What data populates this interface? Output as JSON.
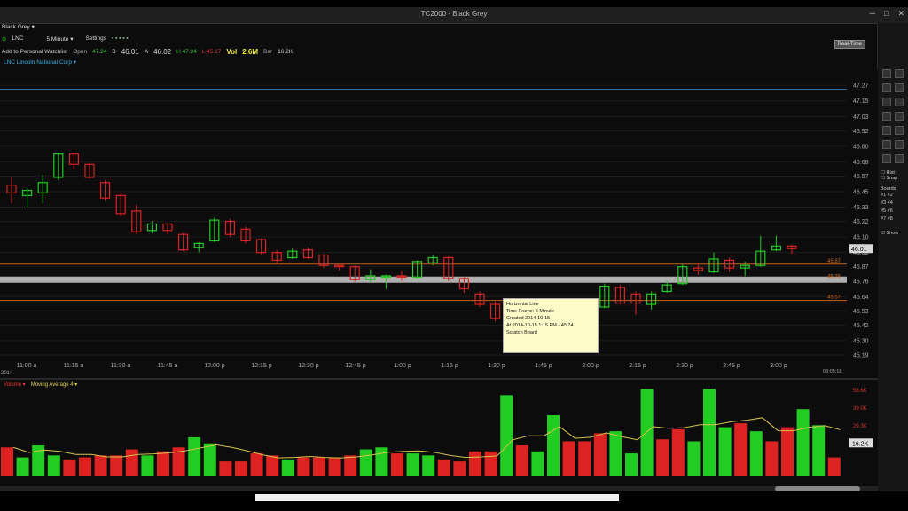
{
  "window": {
    "title": "TC2000 - Black Grey",
    "min": "─",
    "max": "□",
    "close": "✕"
  },
  "layout": {
    "name": "Black Grey ▾"
  },
  "toolbar": {
    "symbol": "LNC",
    "interval": "5 Minute ▾",
    "settings": "Settings"
  },
  "quote": {
    "add_watchlist": "Add to Personal Watchlist",
    "open_label": "Open",
    "open": "47.24",
    "bid_label": "B",
    "bid": "46.01",
    "ask_label": "A",
    "ask": "46.02",
    "high": "H 47.24",
    "low": "L 45.17",
    "vol_label": "Vol",
    "vol": "2.6M",
    "bar_label": "Bar",
    "bar": "16.2K"
  },
  "realtime_button": "Real-Time",
  "symbol_title": "LNC Lincoln National Corp ▾",
  "price_axis": [
    "47.27",
    "47.15",
    "47.03",
    "46.92",
    "46.80",
    "46.68",
    "46.57",
    "46.45",
    "46.33",
    "46.22",
    "46.10",
    "45.98",
    "45.87",
    "45.76",
    "45.64",
    "45.53",
    "45.42",
    "45.30",
    "45.19"
  ],
  "current_price": "46.01",
  "hlines": [
    {
      "price": 47.24,
      "color": "#2f7fc0",
      "label": ""
    },
    {
      "price": 45.89,
      "color": "#d2691e",
      "label": "45.87"
    },
    {
      "price": 45.77,
      "color": "#b8b8b8",
      "label": "45.76"
    },
    {
      "price": 45.61,
      "color": "#d2691e",
      "label": "45.57"
    }
  ],
  "time_axis": [
    "11:00 a",
    "11:15 a",
    "11:30 a",
    "11:45 a",
    "12:00 p",
    "12:15 p",
    "12:30 p",
    "12:45 p",
    "1:00 p",
    "1:15 p",
    "1:30 p",
    "1:45 p",
    "2:00 p",
    "2:15 p",
    "2:30 p",
    "2:45 p",
    "3:00 p"
  ],
  "date_label": "2014",
  "time_right": "03:05:18",
  "tooltip": {
    "title": "Horizontal Line",
    "line1": "Time-Frame: 5 Minute",
    "line2": "Created 2014-10-15",
    "line3": "At 2014-10-15 1:15 PM - 45.74",
    "line4": "Scratch Board"
  },
  "volume_panel": {
    "label": "Volume ▾",
    "ma_label": "Moving Average 4 ▾",
    "current": "16.2K"
  },
  "volume_axis": [
    "58.6K",
    "39.0K",
    "29.3K",
    "19.5K"
  ],
  "right_tools": {
    "hist": "Hist",
    "snap": "Snap",
    "boards": "Boards",
    "show": "Show"
  },
  "chart_data": {
    "type": "candlestick",
    "ylim": [
      45.19,
      47.34
    ],
    "candles": [
      {
        "o": 46.5,
        "h": 46.56,
        "l": 46.36,
        "c": 46.44
      },
      {
        "o": 46.42,
        "h": 46.48,
        "l": 46.33,
        "c": 46.46
      },
      {
        "o": 46.44,
        "h": 46.58,
        "l": 46.36,
        "c": 46.52
      },
      {
        "o": 46.56,
        "h": 46.75,
        "l": 46.54,
        "c": 46.74
      },
      {
        "o": 46.74,
        "h": 46.75,
        "l": 46.62,
        "c": 46.66
      },
      {
        "o": 46.66,
        "h": 46.67,
        "l": 46.55,
        "c": 46.56
      },
      {
        "o": 46.52,
        "h": 46.54,
        "l": 46.38,
        "c": 46.4
      },
      {
        "o": 46.42,
        "h": 46.44,
        "l": 46.26,
        "c": 46.28
      },
      {
        "o": 46.3,
        "h": 46.35,
        "l": 46.12,
        "c": 46.14
      },
      {
        "o": 46.15,
        "h": 46.22,
        "l": 46.13,
        "c": 46.2
      },
      {
        "o": 46.2,
        "h": 46.21,
        "l": 46.12,
        "c": 46.15
      },
      {
        "o": 46.12,
        "h": 46.13,
        "l": 45.99,
        "c": 46.0
      },
      {
        "o": 46.02,
        "h": 46.06,
        "l": 45.98,
        "c": 46.05
      },
      {
        "o": 46.07,
        "h": 46.25,
        "l": 46.06,
        "c": 46.23
      },
      {
        "o": 46.22,
        "h": 46.24,
        "l": 46.1,
        "c": 46.12
      },
      {
        "o": 46.16,
        "h": 46.18,
        "l": 46.05,
        "c": 46.07
      },
      {
        "o": 46.08,
        "h": 46.09,
        "l": 45.96,
        "c": 45.98
      },
      {
        "o": 45.98,
        "h": 46.0,
        "l": 45.89,
        "c": 45.92
      },
      {
        "o": 45.94,
        "h": 46.01,
        "l": 45.93,
        "c": 45.99
      },
      {
        "o": 46.0,
        "h": 46.02,
        "l": 45.93,
        "c": 45.94
      },
      {
        "o": 45.96,
        "h": 45.97,
        "l": 45.86,
        "c": 45.88
      },
      {
        "o": 45.88,
        "h": 45.89,
        "l": 45.84,
        "c": 45.87
      },
      {
        "o": 45.87,
        "h": 45.88,
        "l": 45.75,
        "c": 45.77
      },
      {
        "o": 45.77,
        "h": 45.85,
        "l": 45.75,
        "c": 45.8
      },
      {
        "o": 45.79,
        "h": 45.81,
        "l": 45.7,
        "c": 45.8
      },
      {
        "o": 45.8,
        "h": 45.84,
        "l": 45.76,
        "c": 45.79
      },
      {
        "o": 45.79,
        "h": 45.92,
        "l": 45.78,
        "c": 45.91
      },
      {
        "o": 45.9,
        "h": 45.96,
        "l": 45.88,
        "c": 45.94
      },
      {
        "o": 45.94,
        "h": 45.95,
        "l": 45.76,
        "c": 45.78
      },
      {
        "o": 45.78,
        "h": 45.79,
        "l": 45.67,
        "c": 45.7
      },
      {
        "o": 45.66,
        "h": 45.68,
        "l": 45.56,
        "c": 45.58
      },
      {
        "o": 45.58,
        "h": 45.6,
        "l": 45.45,
        "c": 45.47
      },
      {
        "o": 45.48,
        "h": 45.52,
        "l": 45.26,
        "c": 45.5
      },
      {
        "o": 45.5,
        "h": 45.55,
        "l": 45.44,
        "c": 45.53
      },
      {
        "o": 45.53,
        "h": 45.54,
        "l": 45.42,
        "c": 45.47
      },
      {
        "o": 45.48,
        "h": 45.49,
        "l": 45.38,
        "c": 45.4
      },
      {
        "o": 45.4,
        "h": 45.5,
        "l": 45.38,
        "c": 45.48
      },
      {
        "o": 45.44,
        "h": 45.58,
        "l": 45.43,
        "c": 45.55
      },
      {
        "o": 45.56,
        "h": 45.74,
        "l": 45.55,
        "c": 45.72
      },
      {
        "o": 45.71,
        "h": 45.73,
        "l": 45.58,
        "c": 45.59
      },
      {
        "o": 45.66,
        "h": 45.68,
        "l": 45.5,
        "c": 45.59
      },
      {
        "o": 45.58,
        "h": 45.68,
        "l": 45.54,
        "c": 45.66
      },
      {
        "o": 45.68,
        "h": 45.76,
        "l": 45.67,
        "c": 45.73
      },
      {
        "o": 45.74,
        "h": 45.89,
        "l": 45.73,
        "c": 45.87
      },
      {
        "o": 45.86,
        "h": 45.9,
        "l": 45.81,
        "c": 45.84
      },
      {
        "o": 45.83,
        "h": 45.98,
        "l": 45.82,
        "c": 45.93
      },
      {
        "o": 45.92,
        "h": 45.94,
        "l": 45.83,
        "c": 45.86
      },
      {
        "o": 45.86,
        "h": 45.91,
        "l": 45.8,
        "c": 45.88
      },
      {
        "o": 45.88,
        "h": 46.11,
        "l": 45.87,
        "c": 45.99
      },
      {
        "o": 46.0,
        "h": 46.11,
        "l": 45.99,
        "c": 46.03
      },
      {
        "o": 46.03,
        "h": 46.04,
        "l": 45.97,
        "c": 46.01
      }
    ],
    "volume": [
      {
        "v": 14,
        "up": false
      },
      {
        "v": 9,
        "up": true
      },
      {
        "v": 15,
        "up": true
      },
      {
        "v": 10,
        "up": true
      },
      {
        "v": 8,
        "up": false
      },
      {
        "v": 9,
        "up": false
      },
      {
        "v": 10,
        "up": false
      },
      {
        "v": 10,
        "up": false
      },
      {
        "v": 13,
        "up": false
      },
      {
        "v": 10,
        "up": true
      },
      {
        "v": 12,
        "up": false
      },
      {
        "v": 14,
        "up": false
      },
      {
        "v": 19,
        "up": true
      },
      {
        "v": 16,
        "up": true
      },
      {
        "v": 7,
        "up": false
      },
      {
        "v": 7,
        "up": false
      },
      {
        "v": 11,
        "up": false
      },
      {
        "v": 10,
        "up": false
      },
      {
        "v": 8,
        "up": true
      },
      {
        "v": 9,
        "up": false
      },
      {
        "v": 9,
        "up": false
      },
      {
        "v": 9,
        "up": false
      },
      {
        "v": 10,
        "up": false
      },
      {
        "v": 13,
        "up": true
      },
      {
        "v": 14,
        "up": true
      },
      {
        "v": 11,
        "up": false
      },
      {
        "v": 11,
        "up": true
      },
      {
        "v": 10,
        "up": true
      },
      {
        "v": 8,
        "up": false
      },
      {
        "v": 7,
        "up": false
      },
      {
        "v": 12,
        "up": false
      },
      {
        "v": 12,
        "up": false
      },
      {
        "v": 40,
        "up": true
      },
      {
        "v": 15,
        "up": false
      },
      {
        "v": 12,
        "up": true
      },
      {
        "v": 30,
        "up": true
      },
      {
        "v": 17,
        "up": false
      },
      {
        "v": 17,
        "up": false
      },
      {
        "v": 21,
        "up": false
      },
      {
        "v": 22,
        "up": true
      },
      {
        "v": 11,
        "up": true
      },
      {
        "v": 43,
        "up": true
      },
      {
        "v": 18,
        "up": false
      },
      {
        "v": 23,
        "up": false
      },
      {
        "v": 17,
        "up": true
      },
      {
        "v": 43,
        "up": true
      },
      {
        "v": 24,
        "up": true
      },
      {
        "v": 26,
        "up": false
      },
      {
        "v": 22,
        "up": true
      },
      {
        "v": 17,
        "up": false
      },
      {
        "v": 24,
        "up": false
      },
      {
        "v": 33,
        "up": true
      },
      {
        "v": 25,
        "up": true
      },
      {
        "v": 9,
        "up": false
      }
    ],
    "colors": {
      "up": "#22cc22",
      "down": "#dd2222",
      "ma": "#d6c34a"
    }
  }
}
